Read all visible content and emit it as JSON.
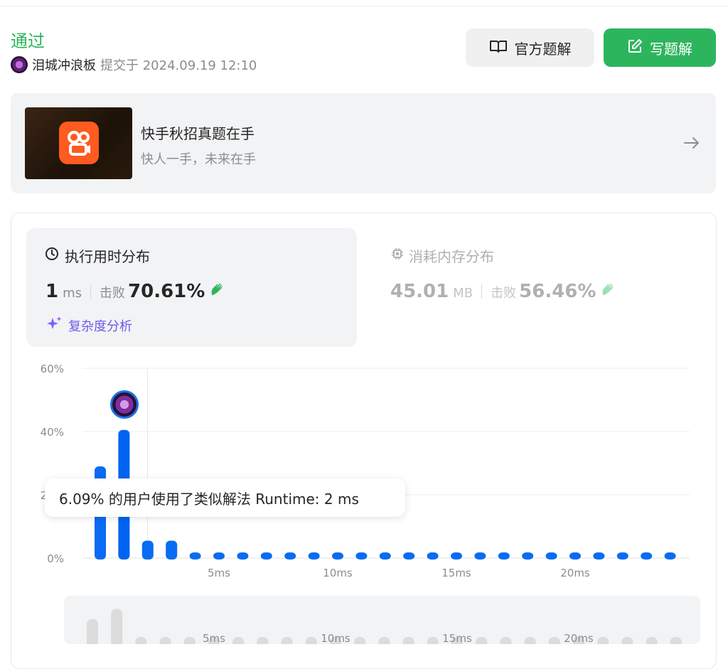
{
  "header": {
    "status": "通过",
    "username": "泪城冲浪板",
    "submitted_text": "提交于 2024.09.19 12:10",
    "official_solution_label": "官方题解",
    "write_solution_label": "写题解"
  },
  "banner": {
    "title": "快手秋招真题在手",
    "subtitle": "快人一手，未来在手"
  },
  "runtime": {
    "title": "执行用时分布",
    "value": "1",
    "unit": "ms",
    "beat_label": "击败",
    "beat_value": "70.61%",
    "analysis_label": "复杂度分析"
  },
  "memory": {
    "title": "消耗内存分布",
    "value": "45.01",
    "unit": "MB",
    "beat_label": "击败",
    "beat_value": "56.46%"
  },
  "tooltip": {
    "text": "6.09% 的用户使用了类似解法 Runtime: 2 ms"
  },
  "colors": {
    "accent_green": "#2db55d",
    "bar_blue": "#0a6cf2",
    "purple": "#6c5ce7"
  },
  "chart_data": {
    "type": "bar",
    "x": [
      0,
      1,
      2,
      3,
      4,
      5,
      6,
      7,
      8,
      9,
      10,
      11,
      12,
      13,
      14,
      15,
      16,
      17,
      18,
      19,
      20,
      21,
      22,
      23,
      24
    ],
    "values": [
      29,
      40.5,
      5.5,
      5.5,
      0.5,
      0.5,
      0.5,
      0.5,
      0.5,
      0.5,
      0.5,
      0.5,
      0.5,
      0.5,
      0.5,
      0.5,
      0.5,
      0.5,
      0.5,
      0.5,
      0.5,
      0.5,
      0.5,
      0.5,
      0.5
    ],
    "ylim": [
      0,
      60
    ],
    "y_ticks": [
      "0%",
      "20%",
      "40%",
      "60%"
    ],
    "x_ticks": [
      {
        "x": 5,
        "label": "5ms"
      },
      {
        "x": 10,
        "label": "10ms"
      },
      {
        "x": 15,
        "label": "15ms"
      },
      {
        "x": 20,
        "label": "20ms"
      }
    ],
    "highlight_x": 1,
    "grid": true
  }
}
